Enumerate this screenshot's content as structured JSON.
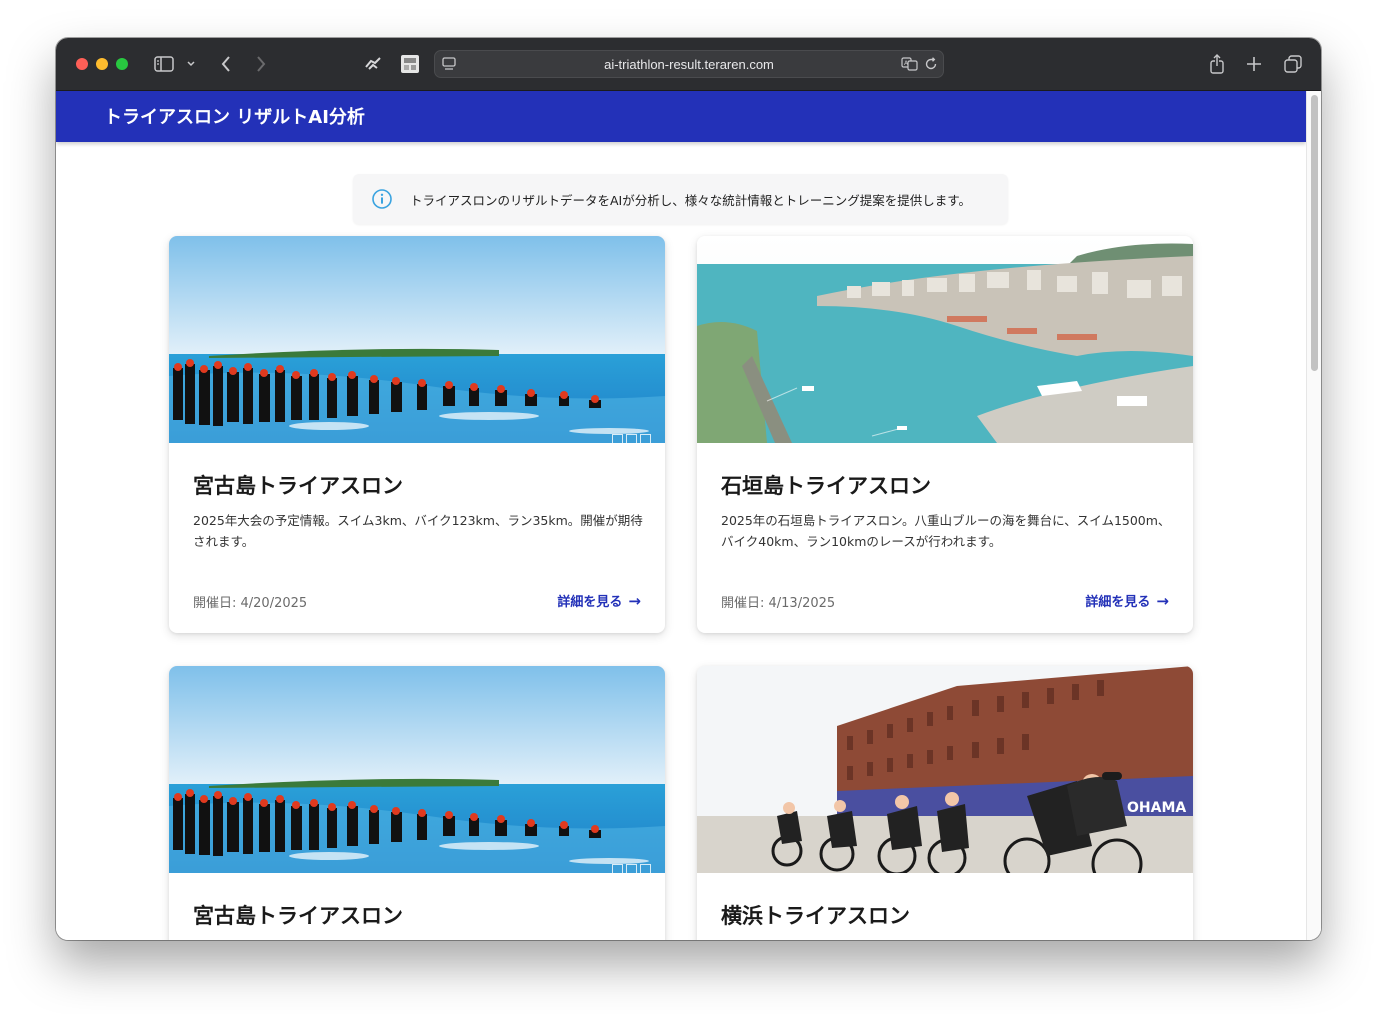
{
  "browser": {
    "url": "ai-triathlon-result.teraren.com"
  },
  "header": {
    "title": "トライアスロン リザルトAI分析"
  },
  "info": {
    "text": "トライアスロンのリザルトデータをAIが分析し、様々な統計情報とトレーニング提案を提供します。"
  },
  "cards": [
    {
      "title": "宮古島トライアスロン",
      "description": "2025年大会の予定情報。スイム3km、バイク123km、ラン35km。開催が期待されます。",
      "date": "開催日: 4/20/2025",
      "link": "詳細を見る",
      "image": "swimmers-beach-photo"
    },
    {
      "title": "石垣島トライアスロン",
      "description": "2025年の石垣島トライアスロン。八重山ブルーの海を舞台に、スイム1500m、バイク40km、ラン10kmのレースが行われます。",
      "date": "開催日: 4/13/2025",
      "link": "詳細を見る",
      "image": "harbor-aerial-photo"
    },
    {
      "title": "宮古島トライアスロン",
      "image": "swimmers-beach-photo"
    },
    {
      "title": "横浜トライアスロン",
      "image": "cyclists-brick-warehouse-photo"
    }
  ],
  "colors": {
    "header_bg": "#2331b8",
    "link": "#2331b8",
    "info_icon": "#3aa3e0"
  }
}
